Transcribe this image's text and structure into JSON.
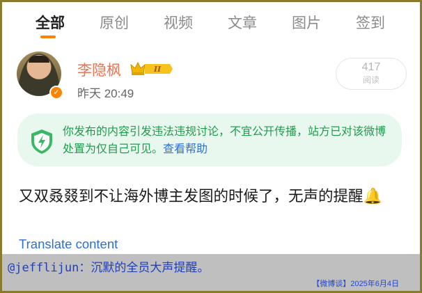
{
  "tabs": [
    {
      "label": "全部",
      "active": true
    },
    {
      "label": "原创"
    },
    {
      "label": "视频"
    },
    {
      "label": "文章"
    },
    {
      "label": "图片"
    },
    {
      "label": "签到"
    }
  ],
  "post": {
    "author": "李隐枫",
    "badge_level": "II",
    "time": "昨天 20:49",
    "read_count": "417",
    "read_label": "阅读",
    "notice_text": "你发布的内容引发违法违规讨论，不宜公开传播，站方已对该微博处置为仅自己可见。",
    "notice_link": "查看帮助",
    "content": "又双叒叕到不让海外博主发图的时候了，无声的提醒",
    "translate_label": "Translate content"
  },
  "caption": {
    "text": "@jefflijun：沉默的全员大声提醒。",
    "credit": "【微博谈】2025年6月4日"
  },
  "colors": {
    "accent": "#ff8200",
    "author": "#eb7350",
    "notice_bg": "#e9f8ee",
    "notice_text": "#1f9b4d",
    "link": "#2d6fd6",
    "caption_bg": "#bfbfbf",
    "caption_text": "#1f3fbf",
    "frame": "#8a7a2e"
  }
}
